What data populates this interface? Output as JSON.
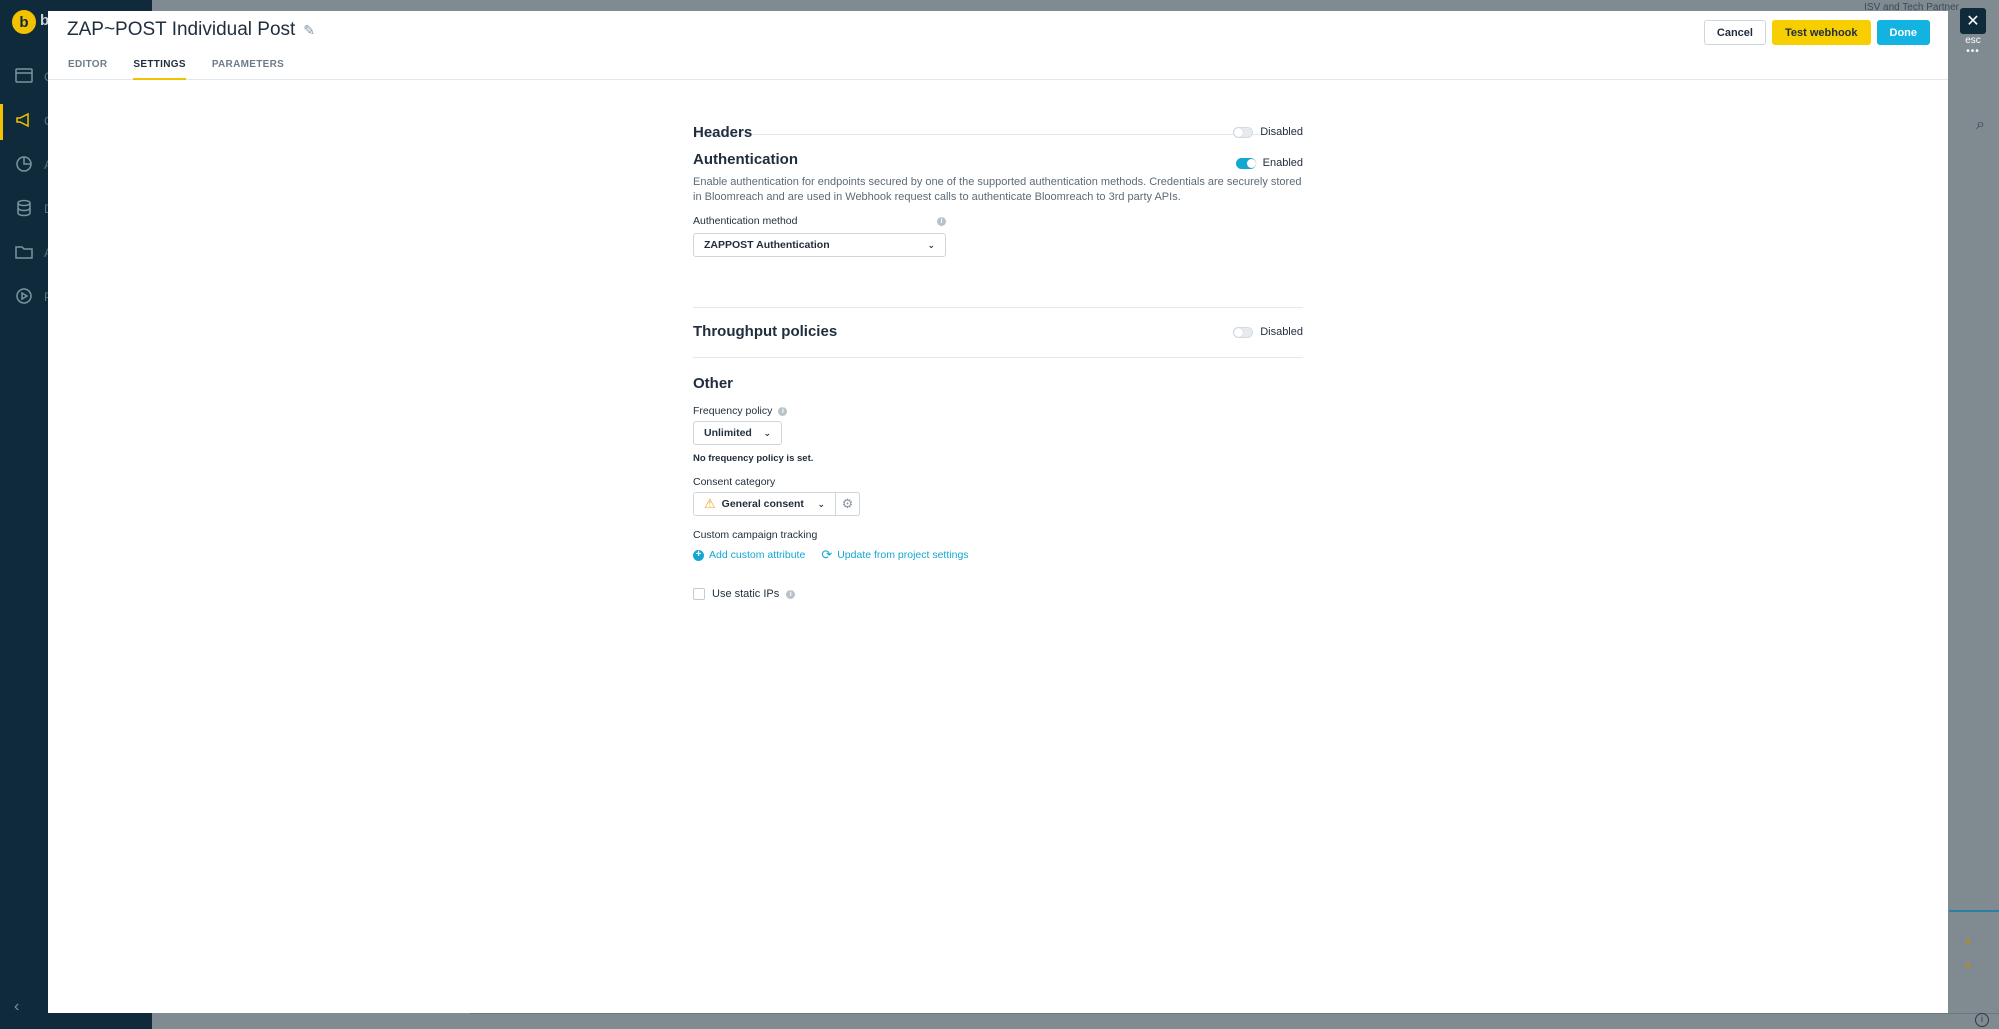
{
  "background": {
    "logo_letter": "b",
    "logo_text": "b",
    "nav_letters": [
      "C",
      "C",
      "A",
      "D",
      "A",
      "P"
    ],
    "top_right_text": "ISV and Tech Partner"
  },
  "close": {
    "icon": "close-icon",
    "esc_label": "esc",
    "more_label": "•••"
  },
  "modal": {
    "title": "ZAP~POST Individual Post",
    "tabs": [
      {
        "label": "EDITOR",
        "active": false
      },
      {
        "label": "SETTINGS",
        "active": true
      },
      {
        "label": "PARAMETERS",
        "active": false
      }
    ],
    "actions": {
      "cancel_label": "Cancel",
      "test_label": "Test webhook",
      "done_label": "Done"
    }
  },
  "settings": {
    "headers": {
      "title": "Headers",
      "toggle_label": "Disabled",
      "enabled": false
    },
    "authentication": {
      "title": "Authentication",
      "toggle_label": "Enabled",
      "enabled": true,
      "description": "Enable authentication for endpoints secured by one of the supported authentication methods. Credentials are securely stored in Bloomreach and are used in Webhook request calls to authenticate Bloomreach to 3rd party APIs.",
      "method_label": "Authentication method",
      "method_value": "ZAPPOST Authentication"
    },
    "throughput": {
      "title": "Throughput policies",
      "toggle_label": "Disabled",
      "enabled": false
    },
    "other": {
      "title": "Other",
      "frequency_label": "Frequency policy",
      "frequency_value": "Unlimited",
      "frequency_note": "No frequency policy is set.",
      "consent_label": "Consent category",
      "consent_value": "General consent",
      "tracking_label": "Custom campaign tracking",
      "add_attribute_label": "Add custom attribute",
      "update_label": "Update from project settings",
      "static_ips_label": "Use static IPs",
      "static_ips_checked": false
    }
  },
  "colors": {
    "accent": "#13b3e1",
    "brand_yellow": "#f7cf00",
    "warning": "#f0a21b",
    "sidebar": "#0f2a3a"
  }
}
